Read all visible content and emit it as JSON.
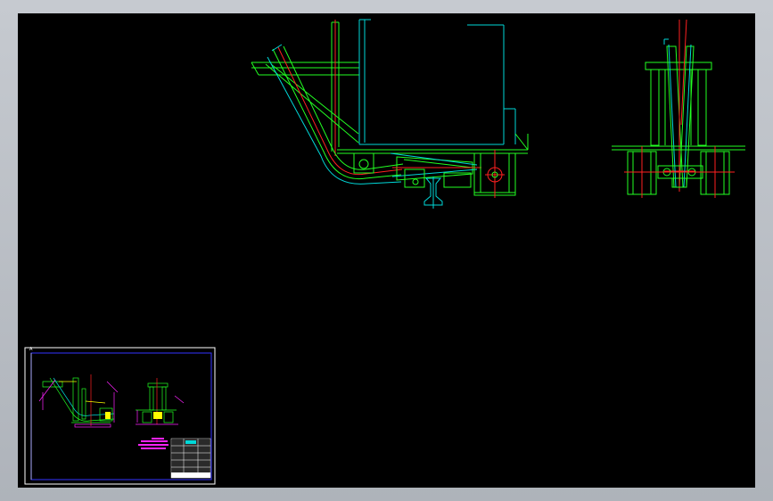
{
  "window": {
    "background": "#b9bec5",
    "canvas_background": "#000000"
  },
  "colors": {
    "outline": "#22ff22",
    "hidden": "#00d8d8",
    "center": "#ff2020",
    "primary": "#ffffff",
    "dimension": "#ff22ff",
    "border": "#3333ff",
    "metal": "#00c8c8"
  },
  "icons": {
    "viewport": "cad-viewport",
    "preview": "sheet-preview-thumbnail"
  },
  "thumbnail": {
    "label": "A"
  }
}
